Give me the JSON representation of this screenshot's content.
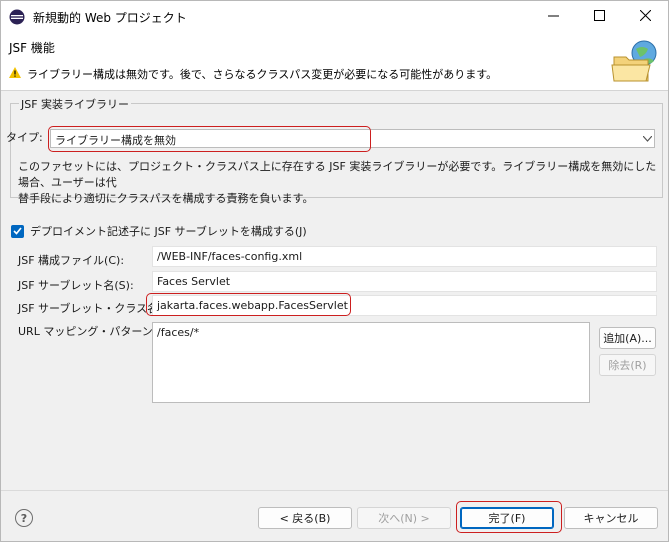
{
  "window": {
    "title": "新規動的 Web プロジェクト"
  },
  "header": {
    "title": "JSF 機能",
    "warning": "ライブラリー構成は無効です。後で、さらなるクラスパス変更が必要になる可能性があります。"
  },
  "library_group": {
    "title": "JSF 実装ライブラリー",
    "type_label": "タイプ:",
    "type_value": "ライブラリー構成を無効",
    "description": "このファセットには、プロジェクト・クラスパス上に存在する JSF 実装ライブラリーが必要です。ライブラリー構成を無効にした場合、ユーザーは代\n替手段により適切にクラスパスを構成する責務を負います。"
  },
  "servlet": {
    "checkbox_label": "デプロイメント記述子に JSF サーブレットを構成する(J)",
    "checked": true,
    "config_label": "JSF 構成ファイル(C):",
    "config_value": "/WEB-INF/faces-config.xml",
    "name_label": "JSF サーブレット名(S):",
    "name_value": "Faces Servlet",
    "class_label": "JSF サーブレット・クラス名(L):",
    "class_value": "jakarta.faces.webapp.FacesServlet",
    "mapping_label": "URL マッピング・パターン(U):",
    "mapping_value": "/faces/*",
    "add_button": "追加(A)...",
    "remove_button": "除去(R)"
  },
  "footer": {
    "help": "?",
    "back": "< 戻る(B)",
    "next": "次へ(N) >",
    "finish": "完了(F)",
    "cancel": "キャンセル"
  },
  "colors": {
    "accent": "#0067c0",
    "highlight": "#cc1f1f",
    "warning": "#f2c200"
  }
}
